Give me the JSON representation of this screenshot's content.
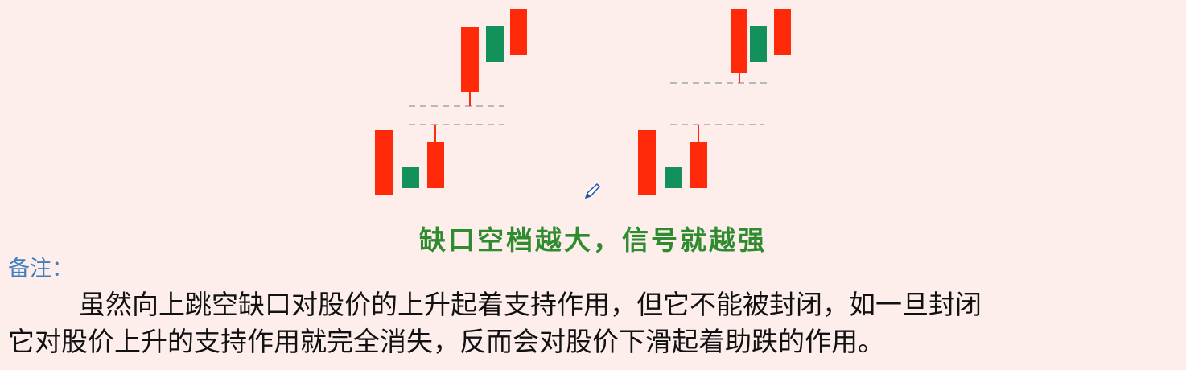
{
  "diagram": {
    "colors": {
      "up": "#ff2a0a",
      "down": "#13915a",
      "gap_line": "#b8b8b8",
      "background": "#fdeeec"
    }
  },
  "caption": "缺口空档越大，信号就越强",
  "note": {
    "label": "备注：",
    "line1": "虽然向上跳空缺口对股价的上升起着支持作用，但它不能被封闭，如一旦封闭",
    "line2": "它对股价上升的支持作用就完全消失，反而会对股价下滑起着助跌的作用。"
  },
  "cursor_icon": "pen-cursor-icon"
}
